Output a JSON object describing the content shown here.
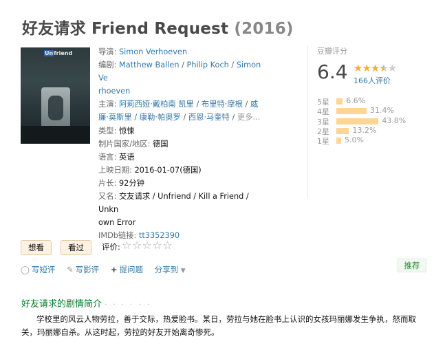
{
  "title": {
    "zh": "好友请求",
    "en": "Friend Request",
    "year": "(2016)"
  },
  "poster": {
    "brand_u": "Un",
    "brand_rest": "friend"
  },
  "info": {
    "director_label": "导演:",
    "director": "Simon Verhoeven",
    "writer_label": "编剧:",
    "writer_1": "Matthew Ballen",
    "writer_2": "Philip Koch",
    "writer_3a": "Simon Ve",
    "writer_3b": "rhoeven",
    "cast_label": "主演:",
    "cast_1": "阿莉西娅·戴柏南 凯里",
    "cast_2": "布里特·摩根",
    "cast_3a": "威",
    "cast_3b": "廉·莫斯里",
    "cast_4": "康勒·帕奥罗",
    "cast_5": "西恩·马奎特",
    "cast_more": "更多...",
    "genre_label": "类型:",
    "genre": "惊悚",
    "country_label": "制片国家/地区:",
    "country": "德国",
    "language_label": "语言:",
    "language": "英语",
    "release_label": "上映日期:",
    "release": "2016-01-07(德国)",
    "runtime_label": "片长:",
    "runtime": "92分钟",
    "aka_label": "又名:",
    "aka_a": "交友请求 / Unfriend / Kill a Friend / Unkn",
    "aka_b": "own Error",
    "imdb_label": "IMDb链接:",
    "imdb": "tt3352390"
  },
  "rating": {
    "header": "豆瓣评分",
    "score": "6.4",
    "stars_filled": 3.5,
    "votes": "166人评价",
    "distribution": [
      {
        "label": "5星",
        "pct": "6.6%",
        "value": 6.6
      },
      {
        "label": "4星",
        "pct": "31.4%",
        "value": 31.4
      },
      {
        "label": "3星",
        "pct": "43.8%",
        "value": 43.8
      },
      {
        "label": "2星",
        "pct": "13.2%",
        "value": 13.2
      },
      {
        "label": "1星",
        "pct": "5.0%",
        "value": 5.0
      }
    ]
  },
  "buttons": {
    "want": "想看",
    "seen": "看过",
    "rate_label": "评价:",
    "recommend": "推荐"
  },
  "actions": {
    "short_review": "写短评",
    "review": "写影评",
    "question": "提问题",
    "share": "分享到"
  },
  "synopsis": {
    "title": "好友请求的剧情简介",
    "dots": "· · · · · ·",
    "text": "学校里的风云人物劳拉，善于交际，热爱脸书。某日，劳拉与她在脸书上认识的女孩玛丽娜发生争执，怒而取关，玛丽娜自杀。从这时起，劳拉的好友开始离奇惨死。"
  },
  "colors": {
    "link": "#3377aa",
    "star": "#ffac2d",
    "bar": "#ffd596",
    "synopsis_title": "#007722"
  }
}
